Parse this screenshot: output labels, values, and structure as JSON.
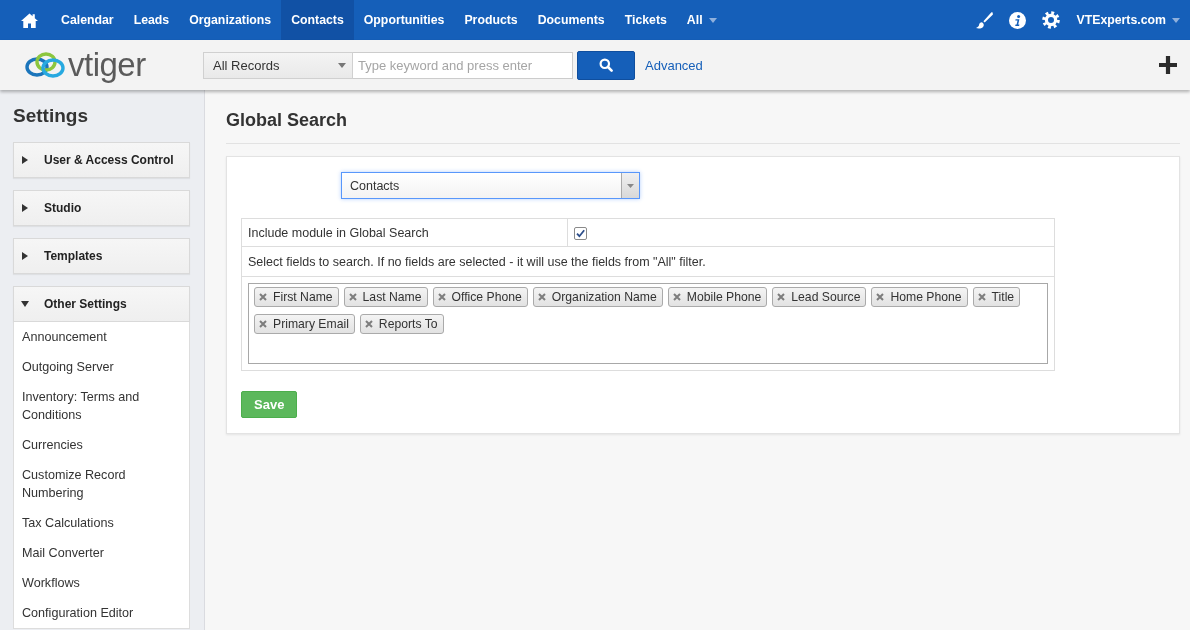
{
  "top_nav": {
    "items": [
      {
        "label": "Calendar",
        "kind": "link",
        "selected": false
      },
      {
        "label": "Leads",
        "kind": "link",
        "selected": false
      },
      {
        "label": "Organizations",
        "kind": "link",
        "selected": false
      },
      {
        "label": "Contacts",
        "kind": "link",
        "selected": true
      },
      {
        "label": "Opportunities",
        "kind": "link",
        "selected": false
      },
      {
        "label": "Products",
        "kind": "link",
        "selected": false
      },
      {
        "label": "Documents",
        "kind": "link",
        "selected": false
      },
      {
        "label": "Tickets",
        "kind": "link",
        "selected": false
      },
      {
        "label": "All",
        "kind": "menu",
        "selected": false
      }
    ],
    "user_menu": "VTExperts.com"
  },
  "header": {
    "logo": "vtiger",
    "scope": "All Records",
    "search_placeholder": "Type keyword and press enter",
    "advanced_link": "Advanced"
  },
  "sidebar": {
    "title": "Settings",
    "sections": [
      {
        "label": "User & Access Control",
        "expanded": false
      },
      {
        "label": "Studio",
        "expanded": false
      },
      {
        "label": "Templates",
        "expanded": false
      },
      {
        "label": "Other Settings",
        "expanded": true,
        "items": [
          {
            "label": "Announcement",
            "selected": false
          },
          {
            "label": "Outgoing Server",
            "selected": false
          },
          {
            "label": "Inventory: Terms and Conditions",
            "selected": false
          },
          {
            "label": "Currencies",
            "selected": false
          },
          {
            "label": "Customize Record Numbering",
            "selected": false
          },
          {
            "label": "Tax Calculations",
            "selected": false
          },
          {
            "label": "Mail Converter",
            "selected": false
          },
          {
            "label": "Workflows",
            "selected": false
          },
          {
            "label": "Configuration Editor",
            "selected": false
          }
        ]
      }
    ]
  },
  "page": {
    "title": "Global Search",
    "module": "Contacts",
    "include_module": {
      "label": "Include module in Global Search",
      "checked": true
    },
    "fields_hint": "Select fields to search. If no fields are selected - it will use the fields from \"All\" filter.",
    "search_fields": [
      "First Name",
      "Last Name",
      "Office Phone",
      "Organization Name",
      "Mobile Phone",
      "Lead Source",
      "Home Phone",
      "Title",
      "Primary Email",
      "Reports To"
    ],
    "save_button": "Save"
  }
}
